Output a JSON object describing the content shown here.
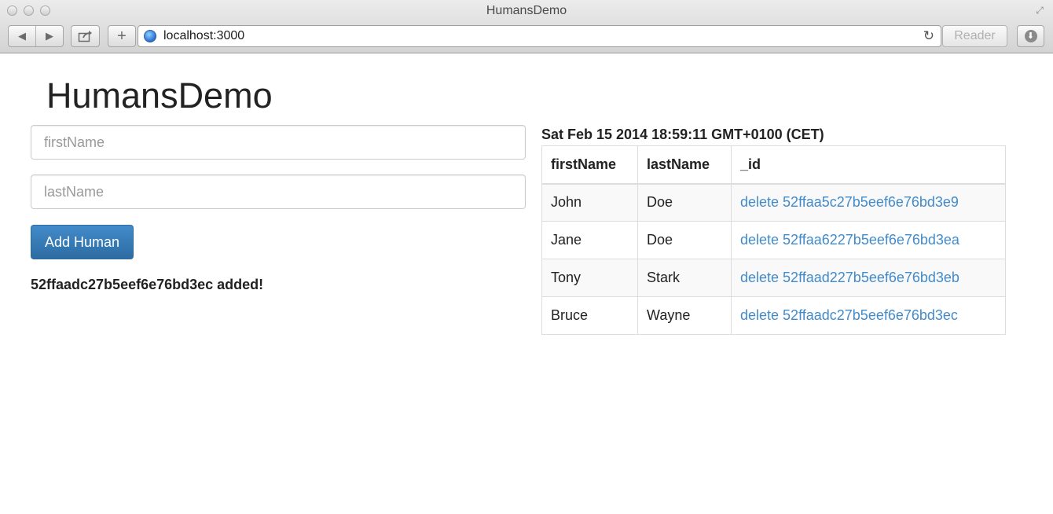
{
  "window": {
    "title": "HumansDemo",
    "url": "localhost:3000",
    "reader_label": "Reader"
  },
  "icons": {
    "back": "back-arrow-icon",
    "forward": "forward-arrow-icon",
    "share": "share-icon",
    "new_tab": "plus-icon",
    "site": "globe-icon",
    "reload": "reload-icon",
    "downloads": "download-icon",
    "fullscreen": "fullscreen-icon"
  },
  "colors": {
    "primary": "#428bca",
    "link": "#428bca",
    "text": "#222222"
  },
  "page": {
    "title": "HumansDemo"
  },
  "form": {
    "first_name_placeholder": "firstName",
    "first_name_value": "",
    "last_name_placeholder": "lastName",
    "last_name_value": "",
    "submit_label": "Add Human",
    "status_message": "52ffaadc27b5eef6e76bd3ec added!"
  },
  "table": {
    "timestamp": "Sat Feb 15 2014 18:59:11 GMT+0100 (CET)",
    "headers": [
      "firstName",
      "lastName",
      "_id"
    ],
    "rows": [
      {
        "firstName": "John",
        "lastName": "Doe",
        "id_link": "delete 52ffaa5c27b5eef6e76bd3e9"
      },
      {
        "firstName": "Jane",
        "lastName": "Doe",
        "id_link": "delete 52ffaa6227b5eef6e76bd3ea"
      },
      {
        "firstName": "Tony",
        "lastName": "Stark",
        "id_link": "delete 52ffaad227b5eef6e76bd3eb"
      },
      {
        "firstName": "Bruce",
        "lastName": "Wayne",
        "id_link": "delete 52ffaadc27b5eef6e76bd3ec"
      }
    ]
  }
}
